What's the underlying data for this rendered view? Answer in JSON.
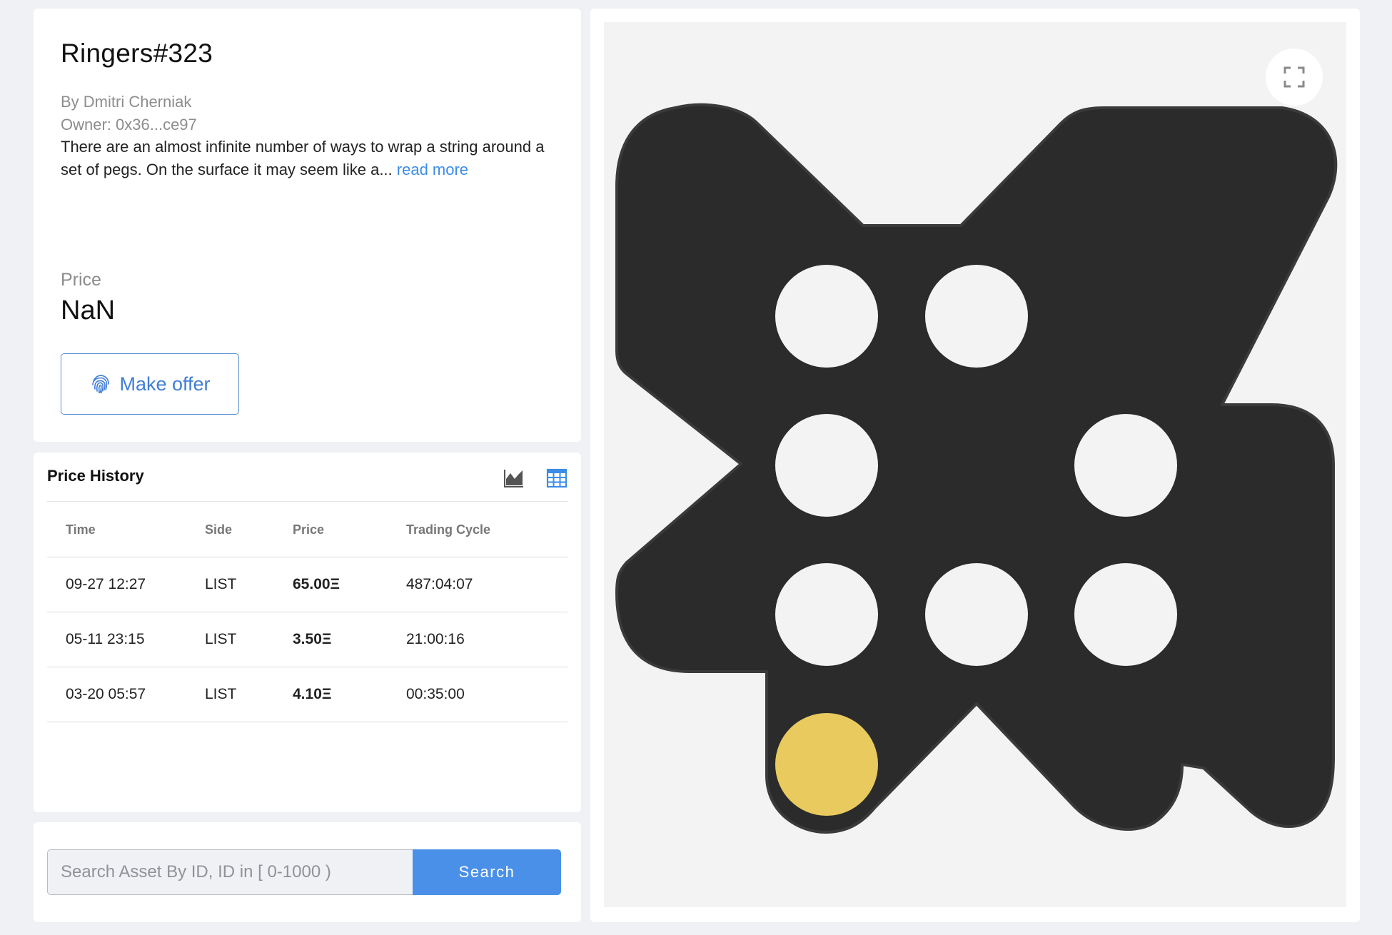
{
  "asset": {
    "title": "Ringers#323",
    "artist": "By Dmitri Cherniak",
    "owner": "Owner: 0x36...ce97",
    "description": "There are an almost infinite number of ways to wrap a string around a set of pegs. On the surface it may seem like a... ",
    "read_more": "read more",
    "price_label": "Price",
    "price_value": "NaN",
    "offer_label": "Make offer"
  },
  "history": {
    "title": "Price History",
    "columns": [
      "Time",
      "Side",
      "Price",
      "Trading Cycle"
    ],
    "rows": [
      {
        "time": "09-27 12:27",
        "side": "LIST",
        "price": "65.00Ξ",
        "cycle": "487:04:07"
      },
      {
        "time": "05-11 23:15",
        "side": "LIST",
        "price": "3.50Ξ",
        "cycle": "21:00:16"
      },
      {
        "time": "03-20 05:57",
        "side": "LIST",
        "price": "4.10Ξ",
        "cycle": "00:35:00"
      }
    ]
  },
  "search": {
    "placeholder": "Search Asset By ID, ID in [ 0-1000 )",
    "button_label": "Search"
  },
  "icons": {
    "offer": "fingerprint-icon",
    "chart_view": "area-chart-icon",
    "table_view": "table-grid-icon",
    "fullscreen": "expand-icon"
  },
  "colors": {
    "accent": "#4a90e8",
    "link": "#3b8de6",
    "art_body": "#2b2b2b",
    "art_peg": "#f3f3f3",
    "art_highlight": "#e8ca5e"
  }
}
